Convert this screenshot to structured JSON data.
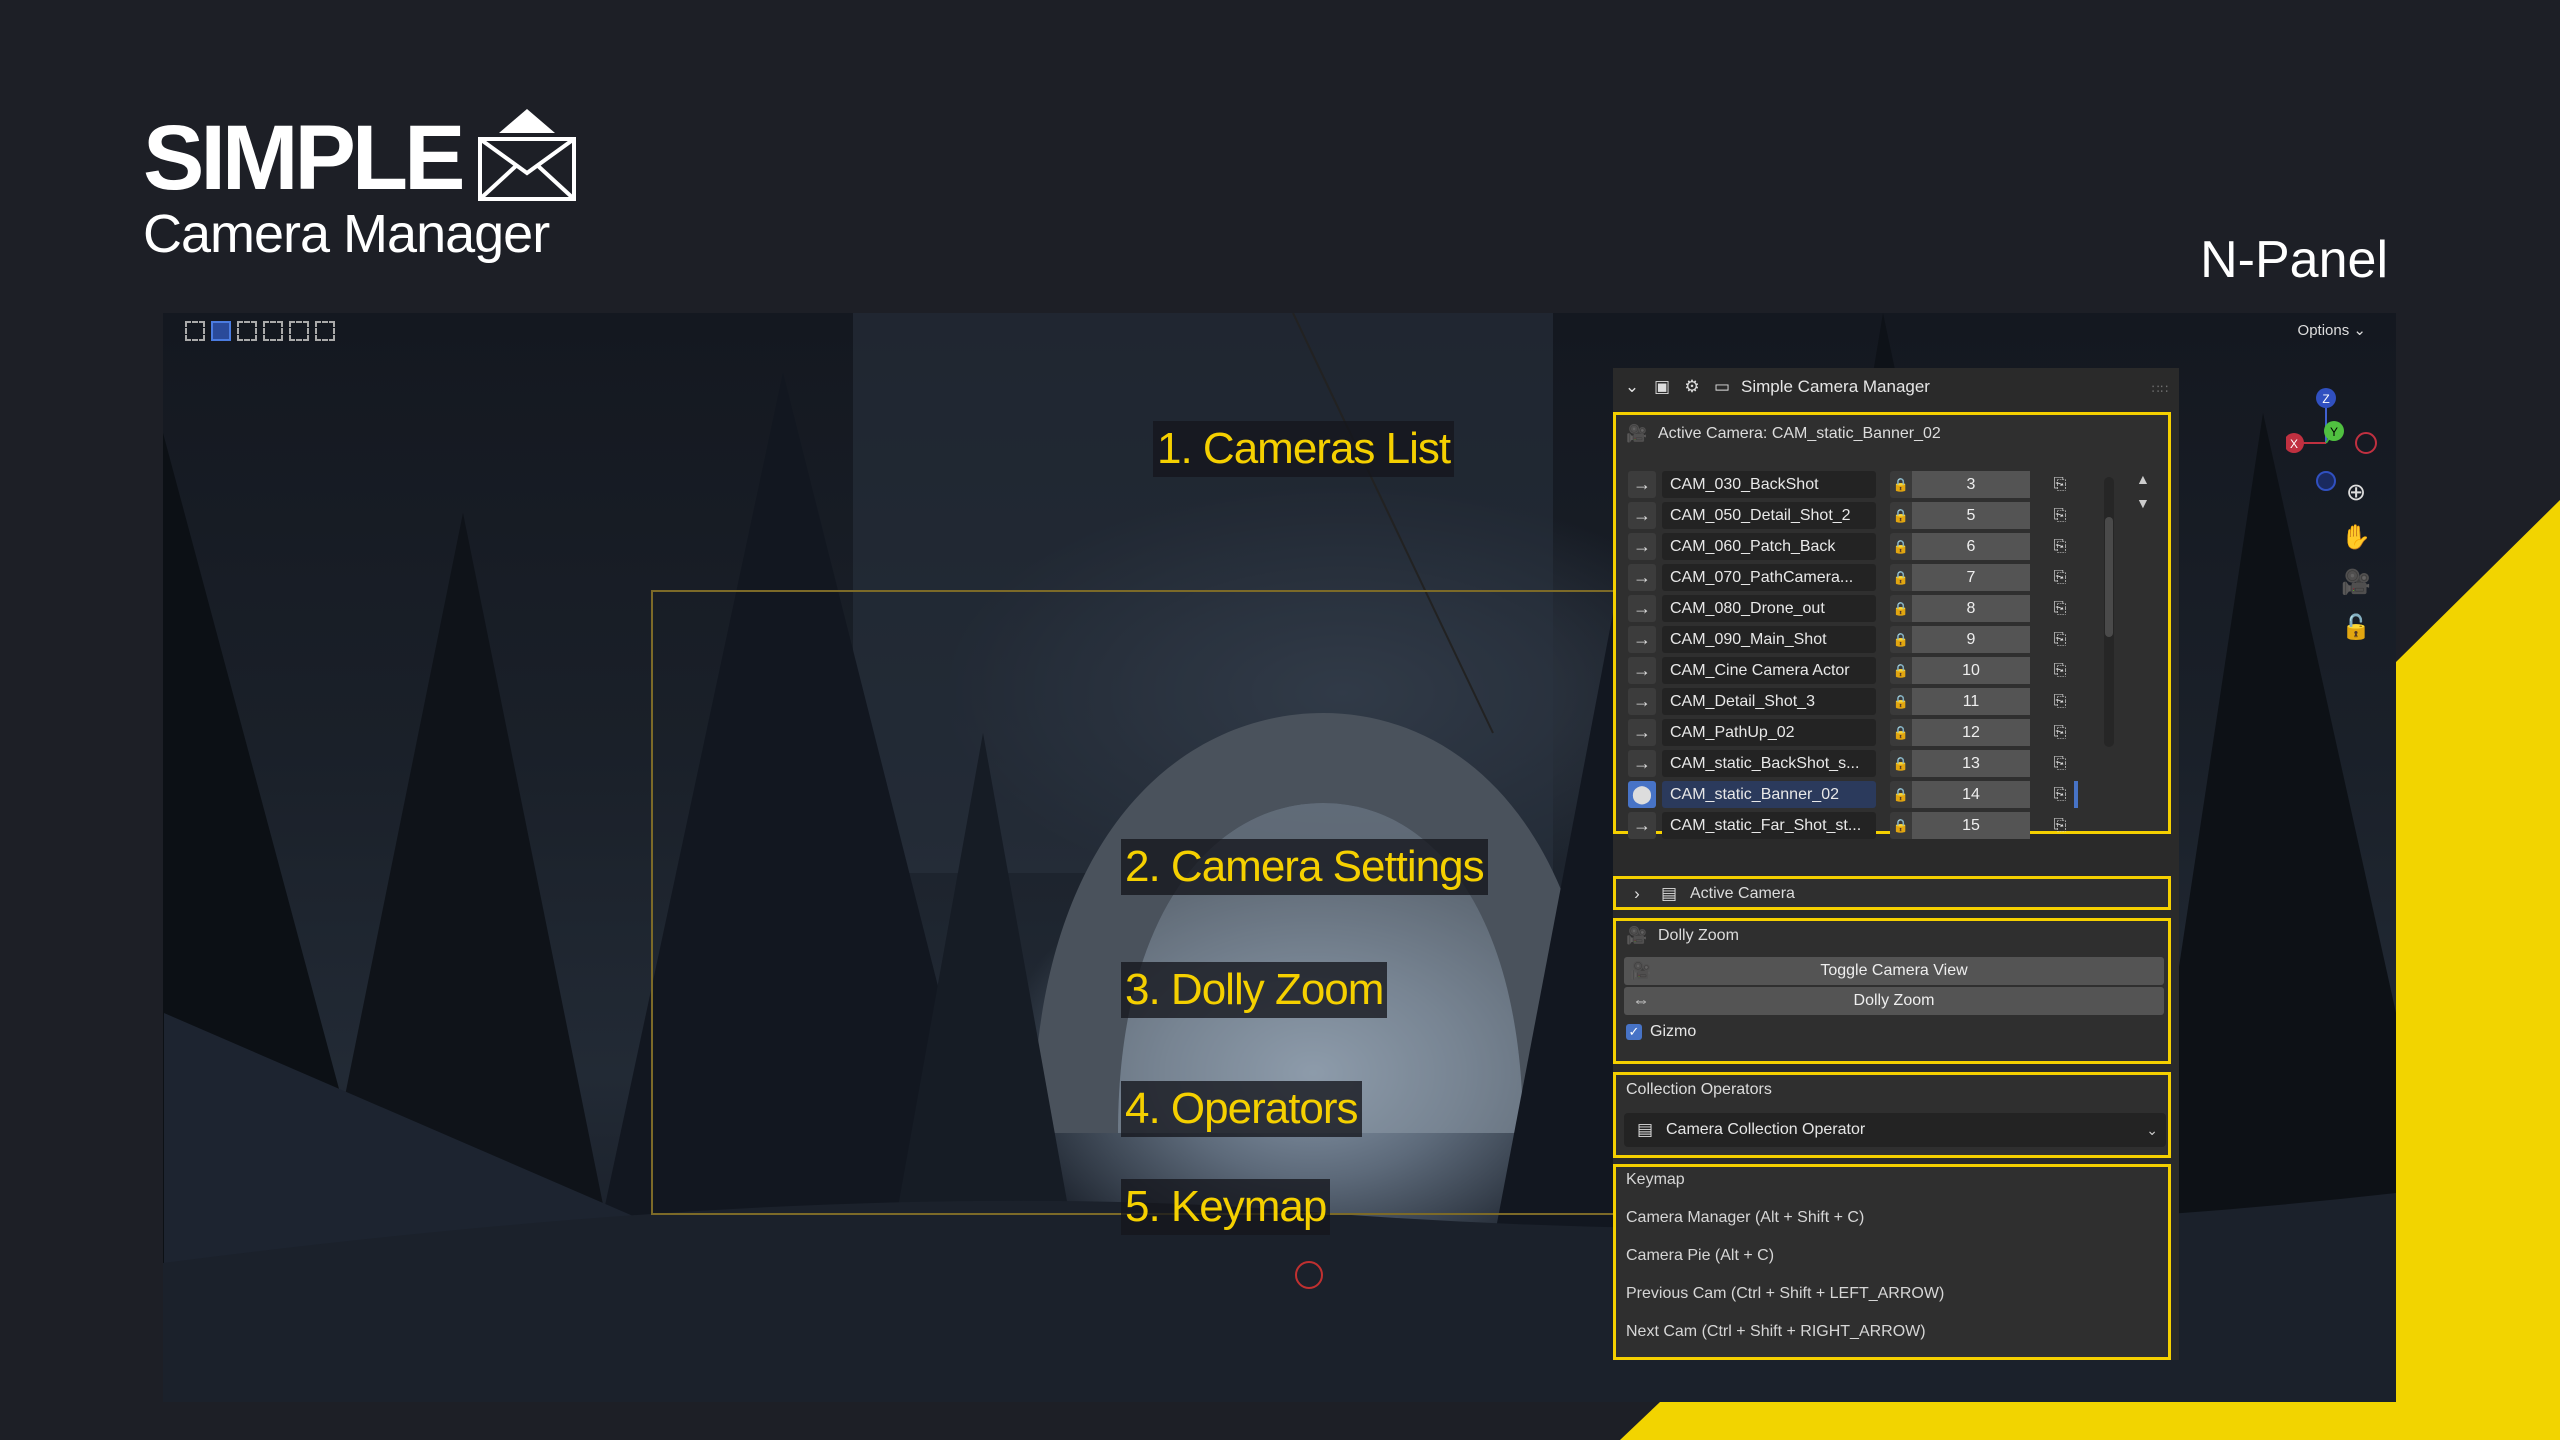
{
  "brand": {
    "title": "SIMPLE",
    "subtitle": "Camera Manager"
  },
  "panel_label": "N-Panel",
  "viewport": {
    "options_label": "Options",
    "callouts": [
      "1. Cameras List",
      "2. Camera Settings",
      "3. Dolly Zoom",
      "4. Operators",
      "5. Keymap"
    ]
  },
  "npanel": {
    "title": "Simple Camera Manager",
    "active_camera_label": "Active Camera: CAM_static_Banner_02",
    "cameras": [
      {
        "name": "CAM_030_BackShot",
        "number": "3"
      },
      {
        "name": "CAM_050_Detail_Shot_2",
        "number": "5"
      },
      {
        "name": "CAM_060_Patch_Back",
        "number": "6"
      },
      {
        "name": "CAM_070_PathCamera...",
        "number": "7"
      },
      {
        "name": "CAM_080_Drone_out",
        "number": "8"
      },
      {
        "name": "CAM_090_Main_Shot",
        "number": "9"
      },
      {
        "name": "CAM_Cine Camera Actor",
        "number": "10"
      },
      {
        "name": "CAM_Detail_Shot_3",
        "number": "11"
      },
      {
        "name": "CAM_PathUp_02",
        "number": "12"
      },
      {
        "name": "CAM_static_BackShot_s...",
        "number": "13"
      },
      {
        "name": "CAM_static_Banner_02",
        "number": "14"
      },
      {
        "name": "CAM_static_Far_Shot_st...",
        "number": "15"
      }
    ],
    "selected_index": 10,
    "active_camera_section": "Active Camera",
    "dolly": {
      "title": "Dolly Zoom",
      "toggle_button": "Toggle Camera View",
      "dolly_button": "Dolly Zoom",
      "gizmo_label": "Gizmo",
      "gizmo_checked": true
    },
    "collection": {
      "title": "Collection Operators",
      "dropdown_value": "Camera Collection Operator"
    },
    "keymap": {
      "title": "Keymap",
      "lines": [
        "Camera Manager (Alt + Shift + C)",
        "Camera Pie (Alt + C)",
        "Previous Cam (Ctrl + Shift + LEFT_ARROW)",
        "Next Cam (Ctrl + Shift + RIGHT_ARROW)"
      ]
    }
  },
  "colors": {
    "accent": "#f5d000",
    "background": "#1d1f26",
    "selection": "#4773c6"
  },
  "gizmo_axes": [
    "Z",
    "Y",
    "X"
  ]
}
